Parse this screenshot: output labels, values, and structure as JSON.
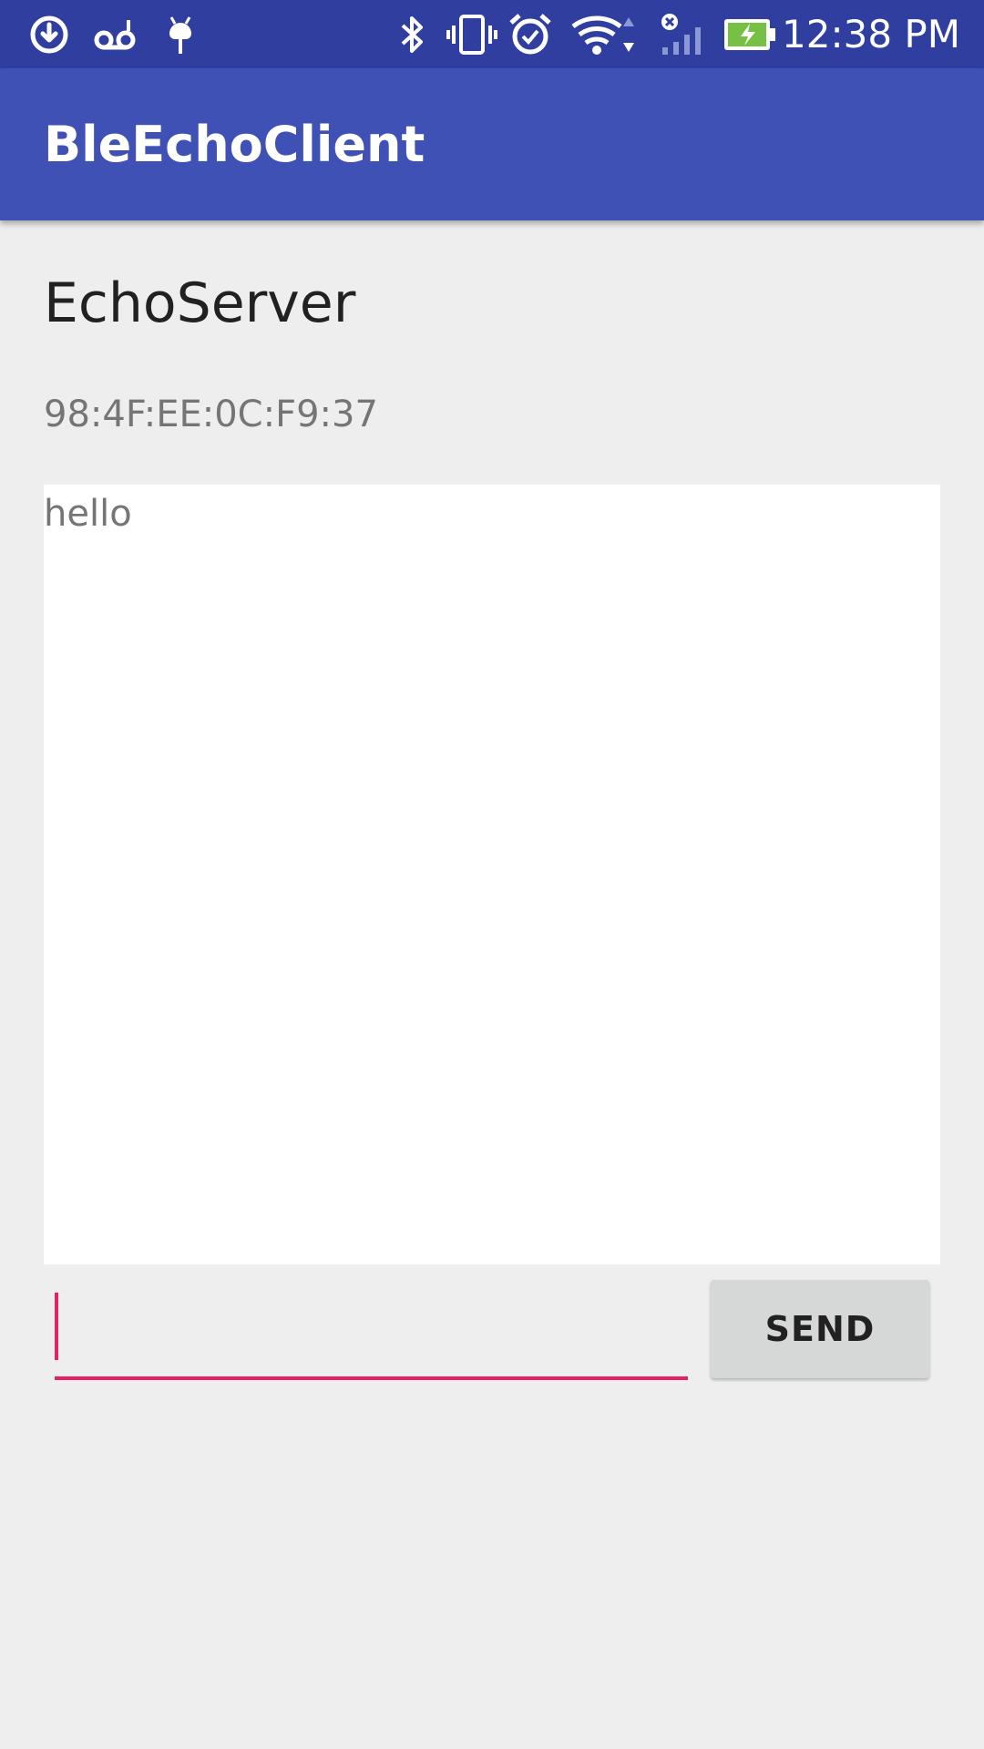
{
  "status_bar": {
    "time": "12:38 PM",
    "icons": [
      "download-icon",
      "voicemail-icon",
      "android-debug-icon",
      "bluetooth-icon",
      "vibrate-icon",
      "alarm-icon",
      "wifi-icon",
      "signal-icon",
      "battery-charging-icon"
    ]
  },
  "toolbar": {
    "title": "BleEchoClient"
  },
  "device": {
    "name": "EchoServer",
    "address": "98:4F:EE:0C:F9:37"
  },
  "log": {
    "lines": [
      "hello"
    ]
  },
  "input": {
    "value": ""
  },
  "send_button": {
    "label": "SEND"
  },
  "colors": {
    "status_bar": "#303f9f",
    "toolbar": "#3f51b5",
    "accent": "#e91e63",
    "background": "#eeeeee"
  }
}
